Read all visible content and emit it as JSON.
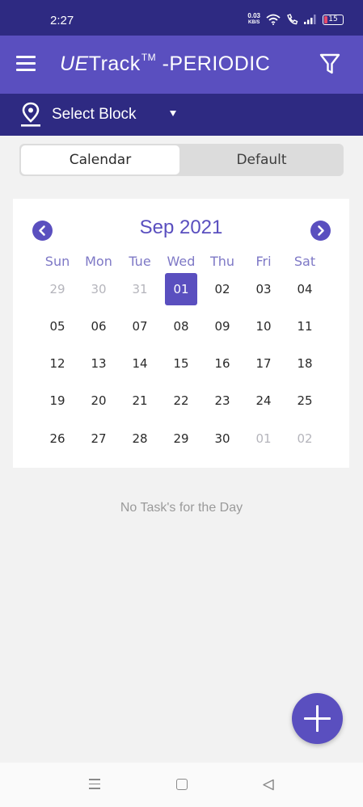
{
  "status_bar": {
    "time": "2:27",
    "net_speed_value": "0.03",
    "net_speed_unit": "KB/S",
    "battery": "15",
    "icons": [
      "wifi-icon",
      "call-icon",
      "signal-icon",
      "battery-icon"
    ]
  },
  "app_bar": {
    "title_brand_a": "UE",
    "title_brand_b": "Track",
    "title_tm": "TM",
    "title_suffix": " -PERIODIC",
    "icons": [
      "menu-icon",
      "filter-icon"
    ]
  },
  "block_bar": {
    "label": "Select Block",
    "icons": [
      "location-pin-icon",
      "dropdown-arrow-icon"
    ]
  },
  "tabs": [
    {
      "label": "Calendar",
      "active": true
    },
    {
      "label": "Default",
      "active": false
    }
  ],
  "calendar": {
    "month_label": "Sep 2021",
    "weekdays": [
      "Sun",
      "Mon",
      "Tue",
      "Wed",
      "Thu",
      "Fri",
      "Sat"
    ],
    "weeks": [
      [
        "29",
        "30",
        "31",
        "01",
        "02",
        "03",
        "04"
      ],
      [
        "05",
        "06",
        "07",
        "08",
        "09",
        "10",
        "11"
      ],
      [
        "12",
        "13",
        "14",
        "15",
        "16",
        "17",
        "18"
      ],
      [
        "19",
        "20",
        "21",
        "22",
        "23",
        "24",
        "25"
      ],
      [
        "26",
        "27",
        "28",
        "29",
        "30",
        "01",
        "02"
      ]
    ],
    "outside_month": [
      [
        0,
        0
      ],
      [
        0,
        1
      ],
      [
        0,
        2
      ],
      [
        4,
        5
      ],
      [
        4,
        6
      ]
    ],
    "selected": [
      0,
      3
    ],
    "colors": {
      "accent": "#5a4fbf",
      "dark": "#2e2a82",
      "muted_day": "#b5b5bc"
    }
  },
  "empty_message": "No Task's for the Day",
  "fab": {
    "icon": "plus-icon"
  },
  "system_nav": {
    "icons": [
      "recents-icon",
      "home-icon",
      "back-icon"
    ]
  }
}
